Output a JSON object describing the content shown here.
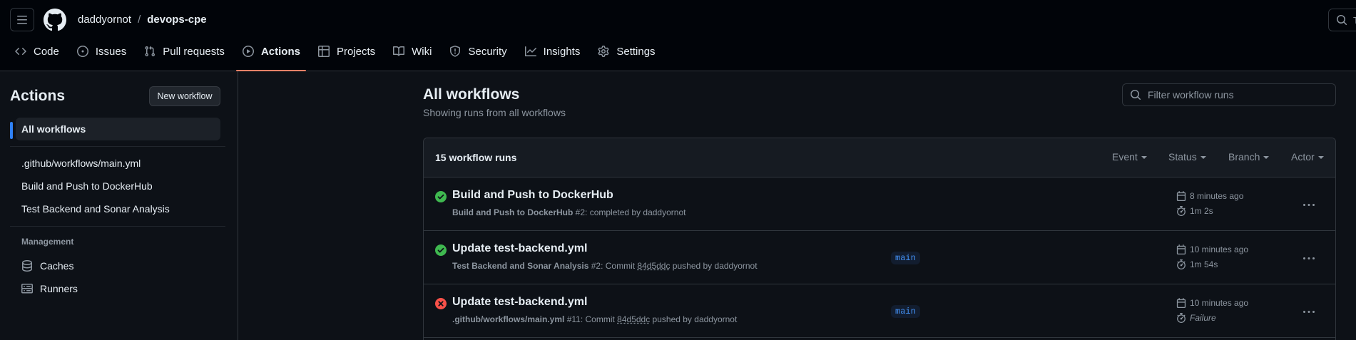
{
  "header": {
    "owner": "daddyornot",
    "separator": "/",
    "repo": "devops-cpe",
    "search_hint": "T"
  },
  "tabs": [
    {
      "label": "Code",
      "icon": "code-icon"
    },
    {
      "label": "Issues",
      "icon": "issue-opened-icon"
    },
    {
      "label": "Pull requests",
      "icon": "pull-request-icon"
    },
    {
      "label": "Actions",
      "icon": "play-icon",
      "selected": true
    },
    {
      "label": "Projects",
      "icon": "table-icon"
    },
    {
      "label": "Wiki",
      "icon": "book-icon"
    },
    {
      "label": "Security",
      "icon": "shield-icon"
    },
    {
      "label": "Insights",
      "icon": "graph-icon"
    },
    {
      "label": "Settings",
      "icon": "gear-icon"
    }
  ],
  "sidebar": {
    "title": "Actions",
    "new_workflow": "New workflow",
    "items": [
      {
        "label": "All workflows",
        "active": true
      },
      {
        "label": ".github/workflows/main.yml"
      },
      {
        "label": "Build and Push to DockerHub"
      },
      {
        "label": "Test Backend and Sonar Analysis"
      }
    ],
    "management_heading": "Management",
    "management": [
      {
        "label": "Caches",
        "icon": "database-icon"
      },
      {
        "label": "Runners",
        "icon": "server-icon"
      }
    ]
  },
  "main": {
    "title": "All workflows",
    "subtitle": "Showing runs from all workflows",
    "filter_placeholder": "Filter workflow runs",
    "run_count": "15 workflow runs",
    "filters": [
      "Event",
      "Status",
      "Branch",
      "Actor"
    ],
    "runs": [
      {
        "status": "success",
        "title": "Build and Push to DockerHub",
        "workflow": "Build and Push to DockerHub",
        "meta": " #2: completed by daddyornot",
        "when": "8 minutes ago",
        "duration": "1m 2s"
      },
      {
        "status": "success",
        "title": "Update test-backend.yml",
        "workflow": "Test Backend and Sonar Analysis",
        "meta_pre": " #2: Commit ",
        "sha": "84d5ddc",
        "meta_post": " pushed by daddyornot",
        "branch": "main",
        "when": "10 minutes ago",
        "duration": "1m 54s"
      },
      {
        "status": "failure",
        "title": "Update test-backend.yml",
        "workflow": ".github/workflows/main.yml",
        "meta_pre": " #11: Commit ",
        "sha": "84d5ddc",
        "meta_post": " pushed by daddyornot",
        "branch": "main",
        "when": "10 minutes ago",
        "duration": "Failure"
      }
    ]
  },
  "colors": {
    "accent": "#2f81f7",
    "tab_underline": "#f78166",
    "success": "#3fb950",
    "failure": "#f85149"
  }
}
